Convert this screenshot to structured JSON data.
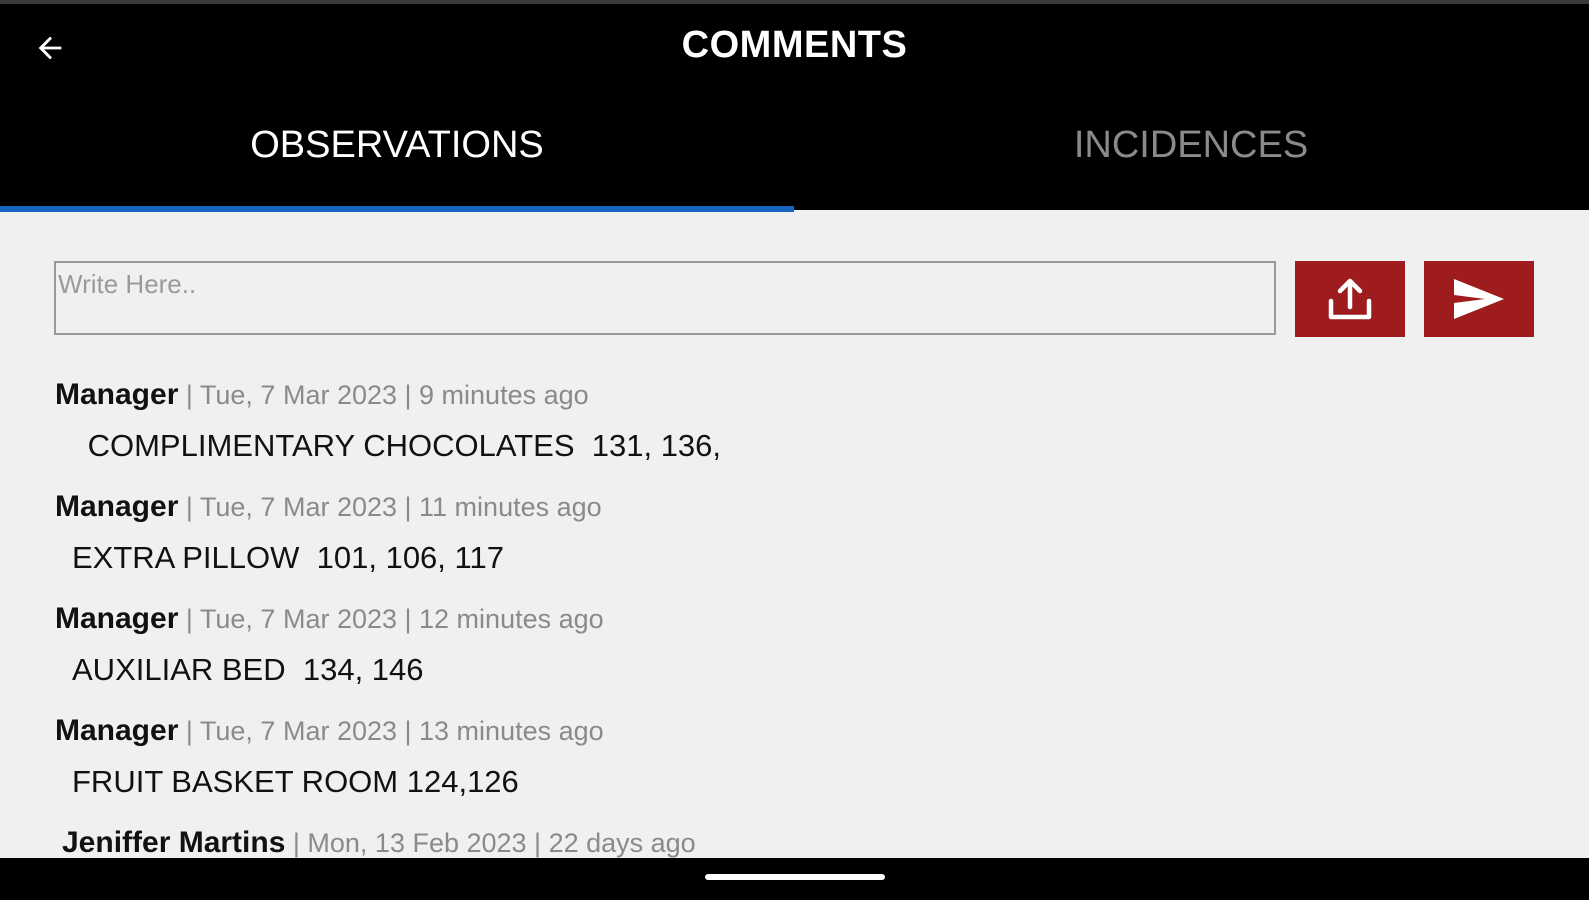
{
  "header": {
    "title": "COMMENTS"
  },
  "tabs": [
    {
      "label": "OBSERVATIONS",
      "active": true
    },
    {
      "label": "INCIDENCES",
      "active": false
    }
  ],
  "composer": {
    "placeholder": "Write Here..",
    "value": ""
  },
  "comments": [
    {
      "author": "Manager",
      "meta": " | Tue, 7 Mar 2023 | 9 minutes ago",
      "text": " COMPLIMENTARY CHOCOLATES  131, 136,"
    },
    {
      "author": "Manager",
      "meta": " | Tue, 7 Mar 2023 | 11 minutes ago",
      "text": "EXTRA PILLOW  101, 106, 117"
    },
    {
      "author": "Manager",
      "meta": " | Tue, 7 Mar 2023 | 12 minutes ago",
      "text": "AUXILIAR BED  134, 146"
    },
    {
      "author": "Manager",
      "meta": " | Tue, 7 Mar 2023 | 13 minutes ago",
      "text": "FRUIT BASKET ROOM 124,126"
    },
    {
      "author": "Jeniffer Martins",
      "meta": " | Mon, 13 Feb 2023 | 22 days ago",
      "text": ""
    }
  ],
  "colors": {
    "appbar": "#000000",
    "accent_tab": "#1565c0",
    "action_button": "#9e1b1e",
    "background": "#f0f0f0"
  },
  "icons": {
    "back": "arrow-left-icon",
    "upload": "upload-icon",
    "send": "send-icon"
  }
}
